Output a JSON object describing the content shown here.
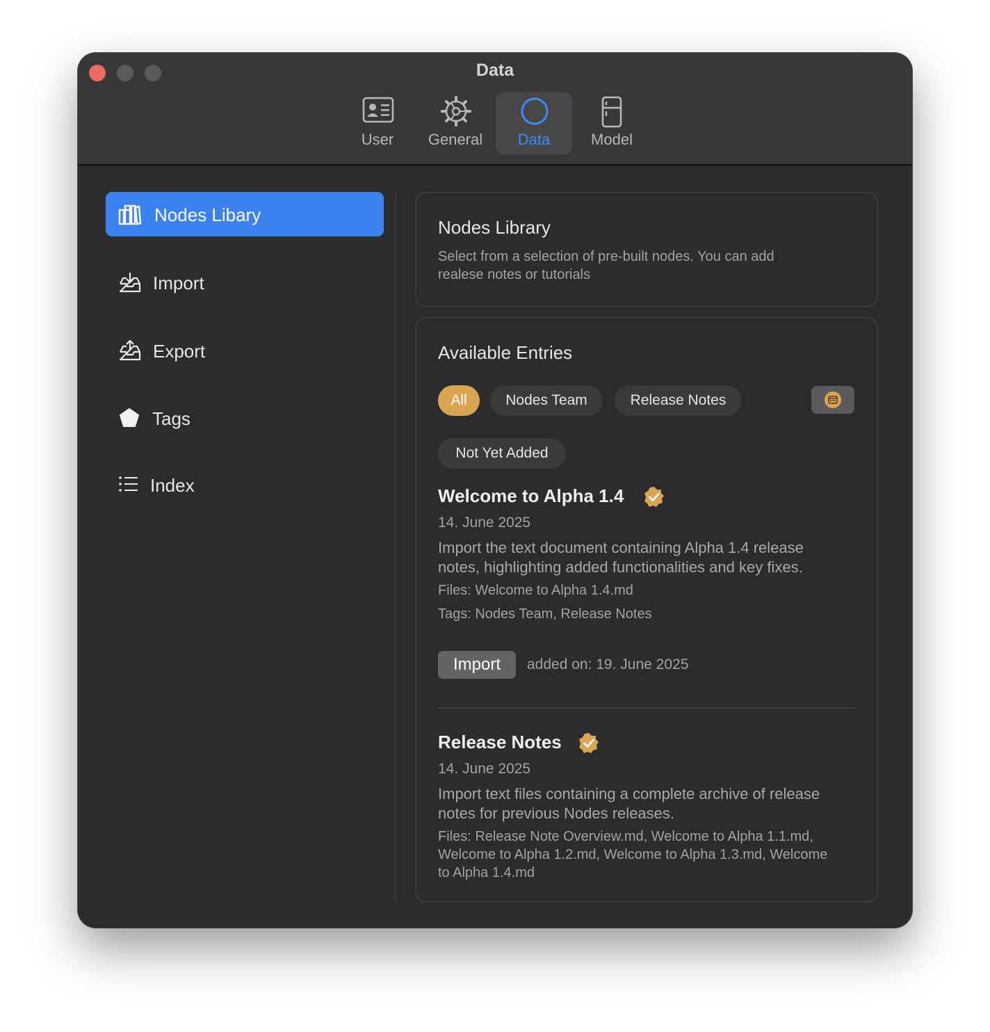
{
  "window": {
    "title": "Data"
  },
  "toolbar": {
    "tabs": [
      {
        "label": "User",
        "icon": "user-card-icon"
      },
      {
        "label": "General",
        "icon": "gear-icon"
      },
      {
        "label": "Data",
        "icon": "circle-icon",
        "active": true
      },
      {
        "label": "Model",
        "icon": "fridge-icon"
      }
    ]
  },
  "sidebar": {
    "items": [
      {
        "label": "Nodes Libary",
        "icon": "books-icon",
        "active": true
      },
      {
        "label": "Import",
        "icon": "tray-download-icon"
      },
      {
        "label": "Export",
        "icon": "tray-upload-icon"
      },
      {
        "label": "Tags",
        "icon": "pentagon-icon"
      },
      {
        "label": "Index",
        "icon": "list-icon"
      }
    ]
  },
  "header_card": {
    "title": "Nodes Library",
    "description_line1": "Select from a selection of pre-built nodes. You can add",
    "description_line2": "realese notes or tutorials"
  },
  "entries_card": {
    "title": "Available Entries",
    "filters": [
      "All",
      "Nodes Team",
      "Release Notes",
      "Not Yet Added"
    ],
    "active_filter": "All",
    "entries": [
      {
        "title": "Welcome to Alpha 1.4",
        "date": "14. June 2025",
        "description_line1": "Import the text document containing Alpha 1.4 release",
        "description_line2": "notes, highlighting added functionalities and key fixes.",
        "files": "Files: Welcome to Alpha 1.4.md",
        "tags": "Tags: Nodes Team, Release Notes",
        "button_label": "Import",
        "added_on": "added on: 19. June 2025"
      },
      {
        "title": "Release Notes",
        "date": "14. June 2025",
        "description_line1": "Import text files containing a complete archive of release",
        "description_line2": "notes for previous Nodes releases.",
        "files_line1": "Files: Release Note Overview.md, Welcome to Alpha 1.1.md,",
        "files_line2": "Welcome to Alpha 1.2.md, Welcome to Alpha 1.3.md, Welcome",
        "files_line3": "to Alpha 1.4.md"
      }
    ]
  },
  "colors": {
    "accent_blue": "#3b82f0",
    "badge_gold": "#d9a552",
    "close_red": "#ed6a5e"
  }
}
